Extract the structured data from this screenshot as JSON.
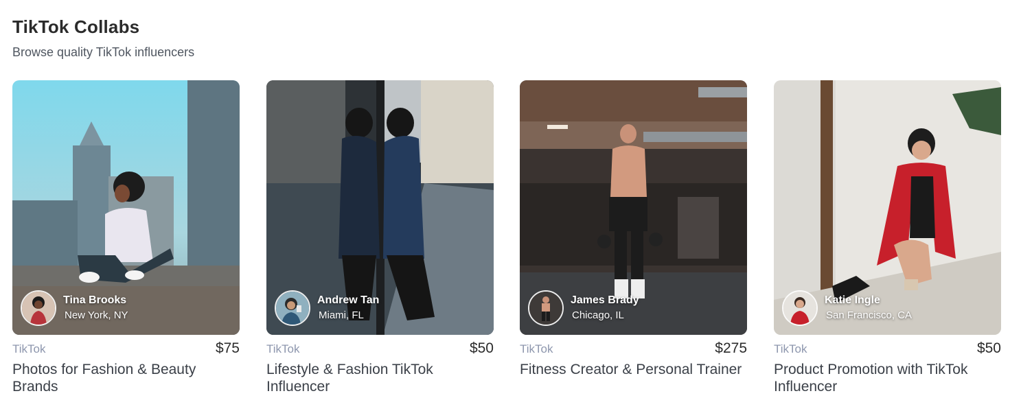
{
  "section": {
    "title": "TikTok Collabs",
    "subtitle": "Browse quality TikTok influencers"
  },
  "cards": [
    {
      "creator_name": "Tina Brooks",
      "location": "New York, NY",
      "platform": "TikTok",
      "price": "$75",
      "title": "Photos for Fashion & Beauty Brands"
    },
    {
      "creator_name": "Andrew Tan",
      "location": "Miami, FL",
      "platform": "TikTok",
      "price": "$50",
      "title": "Lifestyle & Fashion TikTok Influencer"
    },
    {
      "creator_name": "James Brady",
      "location": "Chicago, IL",
      "platform": "TikTok",
      "price": "$275",
      "title": "Fitness Creator & Personal Trainer"
    },
    {
      "creator_name": "Katie Ingle",
      "location": "San Francisco, CA",
      "platform": "TikTok",
      "price": "$50",
      "title": "Product Promotion with TikTok Influencer"
    }
  ]
}
